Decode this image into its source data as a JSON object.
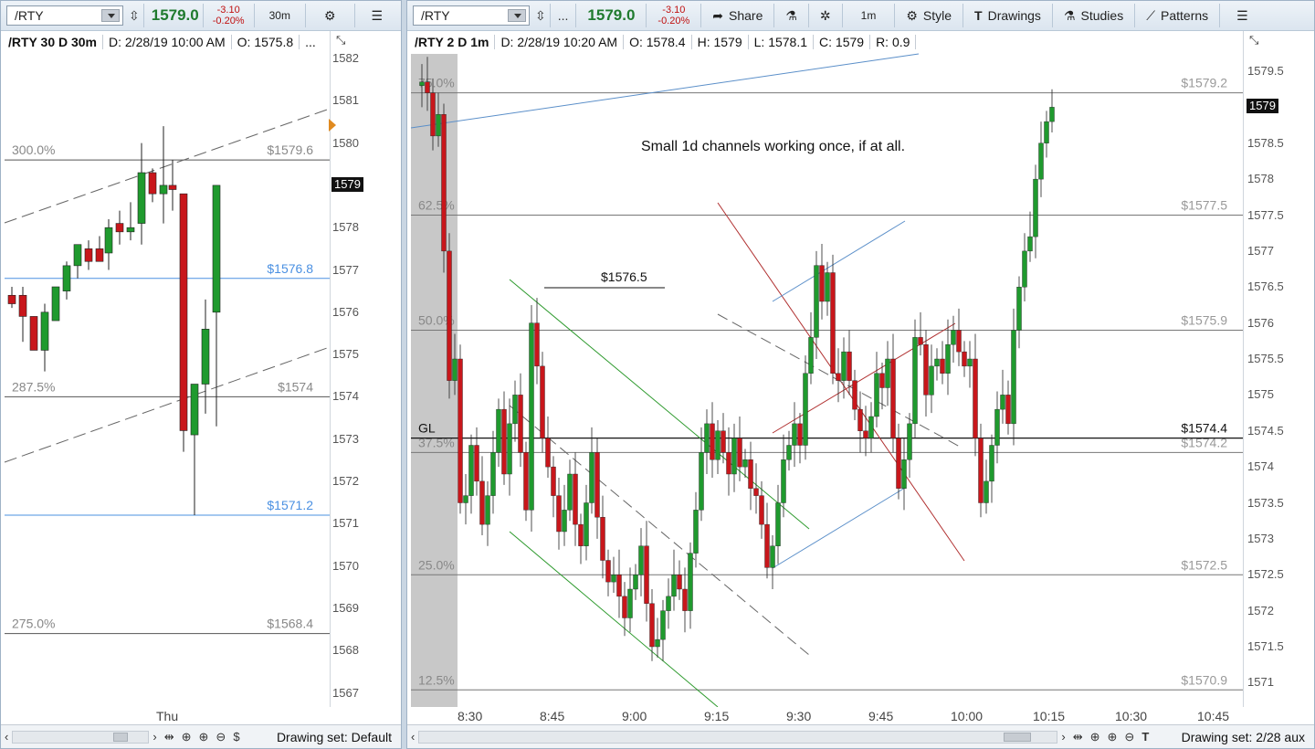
{
  "left": {
    "symbol": "/RTY",
    "price": "1579.0",
    "change": "-3.10",
    "change_pct": "-0.20%",
    "timeframe_btn": "30m",
    "info": {
      "title": "/RTY 30 D 30m",
      "date": "D: 2/28/19 10:00 AM",
      "open": "O: 1575.8",
      "more": "..."
    },
    "last_price": "1579",
    "price_axis": [
      "1582",
      "1581",
      "1580",
      "1579",
      "1578",
      "1577",
      "1576",
      "1575",
      "1574",
      "1573",
      "1572",
      "1571",
      "1570",
      "1569",
      "1568",
      "1567"
    ],
    "fib_levels": [
      {
        "pct": "300.0%",
        "price": "$1579.6"
      },
      {
        "pct": "",
        "price": "$1576.8"
      },
      {
        "pct": "287.5%",
        "price": "$1574"
      },
      {
        "pct": "",
        "price": "$1571.2"
      },
      {
        "pct": "275.0%",
        "price": "$1568.4"
      }
    ],
    "time_axis": [
      "Thu"
    ],
    "drawing_set": "Drawing set: Default"
  },
  "right": {
    "symbol": "/RTY",
    "more": "...",
    "price": "1579.0",
    "change": "-3.10",
    "change_pct": "-0.20%",
    "toolbar": {
      "share": "Share",
      "timeframe": "1m",
      "style": "Style",
      "drawings": "Drawings",
      "studies": "Studies",
      "patterns": "Patterns"
    },
    "info": {
      "title": "/RTY 2 D 1m",
      "date": "D: 2/28/19 10:20 AM",
      "open": "O: 1578.4",
      "high": "H: 1579",
      "low": "L: 1578.1",
      "close": "C: 1579",
      "range": "R: 0.9"
    },
    "last_price": "1579",
    "price_axis": [
      "1579.5",
      "1579",
      "1578.5",
      "1578",
      "1577.5",
      "1577",
      "1576.5",
      "1576",
      "1575.5",
      "1575",
      "1574.5",
      "1574",
      "1573.5",
      "1573",
      "1572.5",
      "1572",
      "1571.5",
      "1571"
    ],
    "fib_levels": [
      {
        "pct": "75.0%",
        "price": "$1579.2"
      },
      {
        "pct": "62.5%",
        "price": "$1577.5"
      },
      {
        "pct": "50.0%",
        "price": "$1575.9"
      },
      {
        "pct": "37.5%",
        "price": "$1574.2"
      },
      {
        "pct": "25.0%",
        "price": "$1572.5"
      },
      {
        "pct": "12.5%",
        "price": "$1570.9"
      }
    ],
    "gl_label": "GL",
    "gl_price": "$1574.4",
    "annotation": "Small 1d channels working once, if at all.",
    "high_label": "$1576.5",
    "time_axis": [
      "8:30",
      "8:45",
      "9:00",
      "9:15",
      "9:30",
      "9:45",
      "10:00",
      "10:15",
      "10:30",
      "10:45"
    ],
    "drawing_set": "Drawing set: 2/28 aux"
  },
  "colors": {
    "up": "#1f9a2e",
    "down": "#c8161b",
    "fib_blue": "#4a90e2",
    "channel_green": "#2e9a2e",
    "channel_red": "#b03030"
  }
}
